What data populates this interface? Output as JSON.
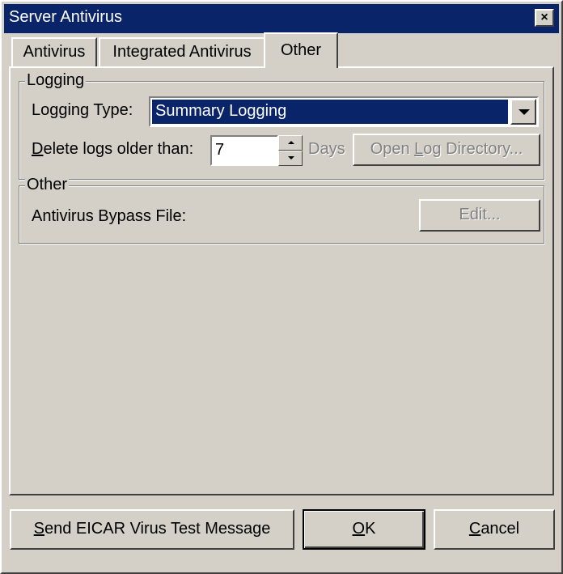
{
  "window": {
    "title": "Server Antivirus",
    "close_glyph": "×",
    "close_icon": "close-icon"
  },
  "tabs": [
    {
      "label": "Antivirus",
      "active": false
    },
    {
      "label": "Integrated Antivirus",
      "active": false
    },
    {
      "label": "Other",
      "active": true
    }
  ],
  "logging": {
    "group_label": "Logging",
    "type_label": "Logging Type:",
    "type_value": "Summary Logging",
    "delete_label_prefix": "",
    "delete_label_accel": "D",
    "delete_label_rest": "elete logs older than:",
    "days_value": "7",
    "days_unit": "Days",
    "open_log_dir_pre": "Open ",
    "open_log_dir_accel": "L",
    "open_log_dir_post": "og Directory..."
  },
  "other": {
    "group_label": "Other",
    "bypass_label": "Antivirus Bypass File:",
    "edit_label": "Edit..."
  },
  "buttons": {
    "eicar_accel": "S",
    "eicar_rest": "end EICAR Virus Test Message",
    "ok_accel": "O",
    "ok_rest": "K",
    "cancel_accel": "C",
    "cancel_rest": "ancel"
  },
  "colors": {
    "face": "#d4d0c8",
    "title_bg": "#0a246a",
    "selection": "#0a246a"
  }
}
